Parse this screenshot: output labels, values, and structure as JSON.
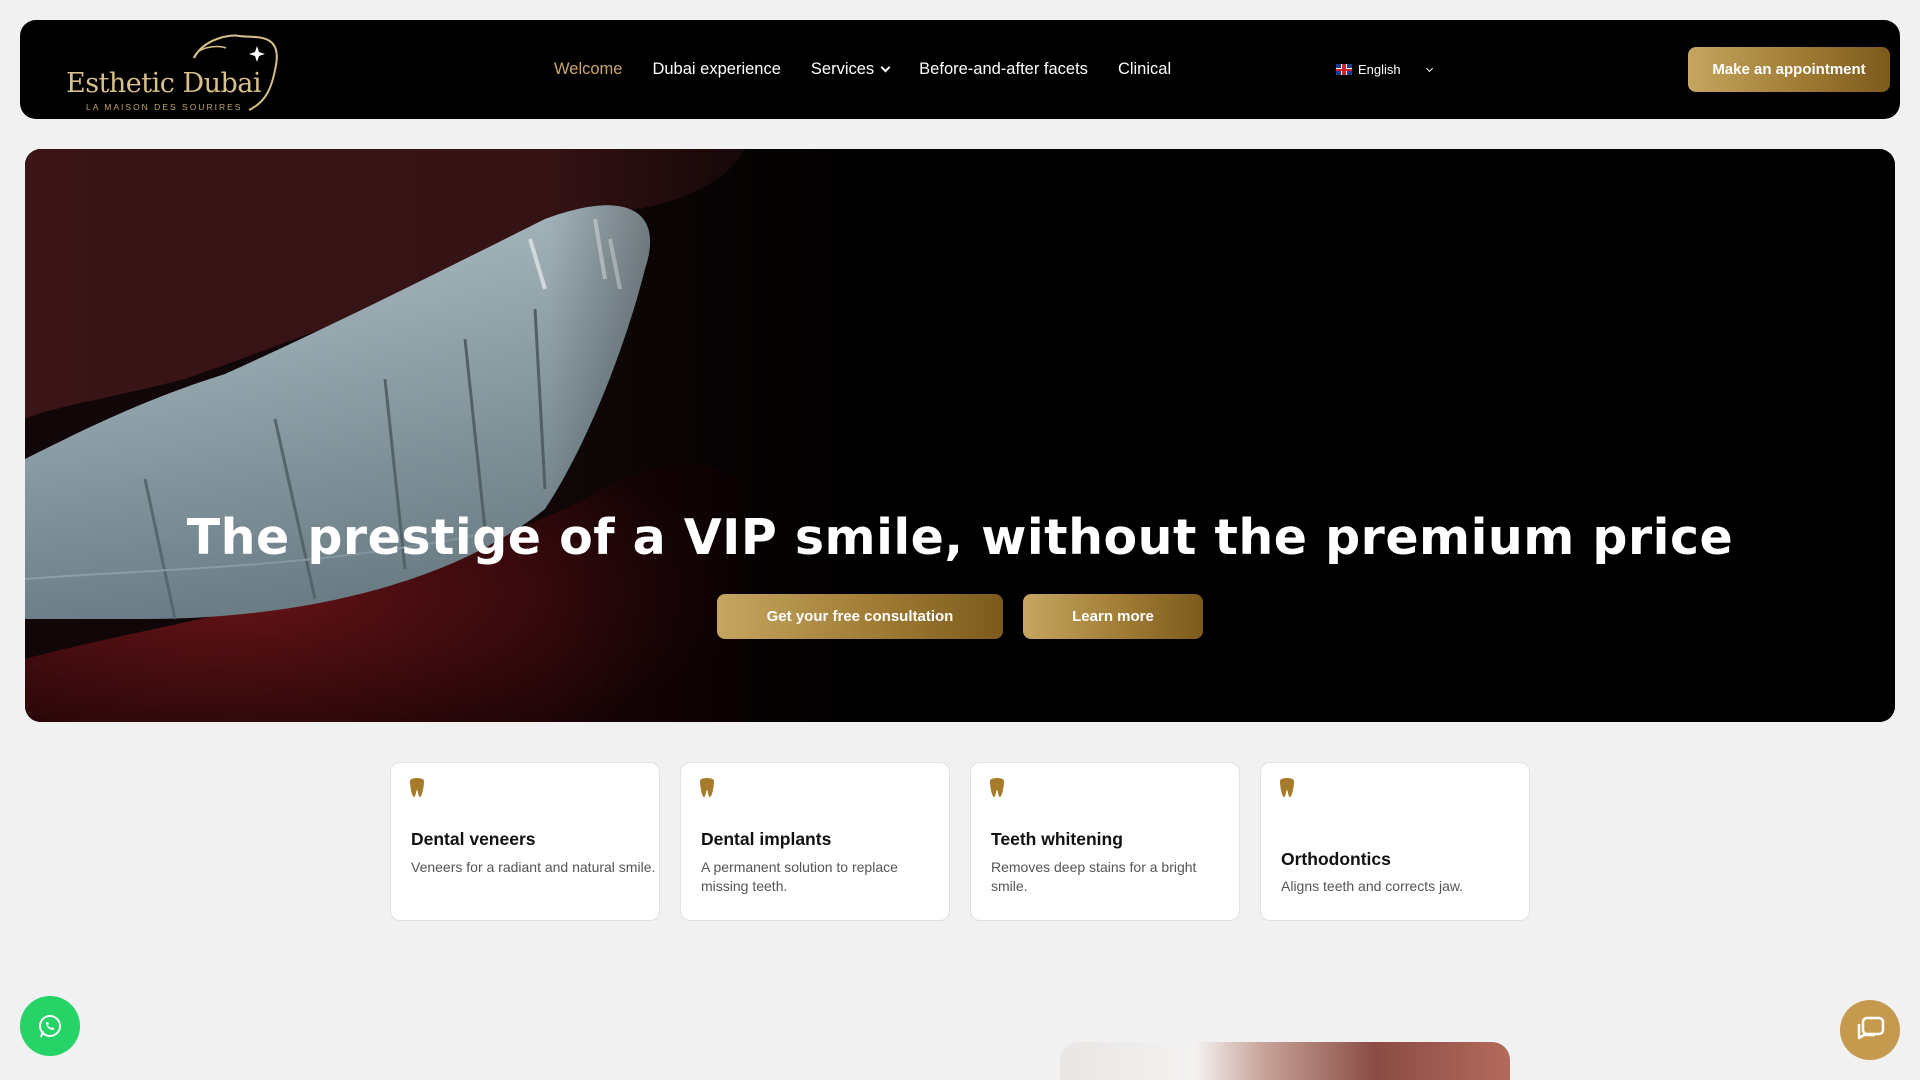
{
  "brand": {
    "name": "Esthetic Dubai",
    "tagline": "LA MAISON DES SOURIRES",
    "accent_color": "#c9a66b"
  },
  "nav": {
    "items": [
      {
        "label": "Welcome",
        "active": true
      },
      {
        "label": "Dubai experience",
        "active": false
      },
      {
        "label": "Services",
        "active": false,
        "has_dropdown": true
      },
      {
        "label": "Before-and-after facets",
        "active": false
      },
      {
        "label": "Clinical",
        "active": false
      }
    ]
  },
  "language": {
    "selected": "English",
    "flag_icon": "uk-flag-icon"
  },
  "header": {
    "cta_label": "Make an appointment"
  },
  "hero": {
    "title": "The prestige of a VIP smile, without the premium price",
    "primary_cta": "Get your free consultation",
    "secondary_cta": "Learn more"
  },
  "services": [
    {
      "icon": "tooth-icon",
      "title": "Dental veneers",
      "description": "Veneers for a radiant and natural smile."
    },
    {
      "icon": "tooth-icon",
      "title": "Dental implants",
      "description": "A permanent solution to replace missing teeth."
    },
    {
      "icon": "tooth-icon",
      "title": "Teeth whitening",
      "description": "Removes deep stains for a bright smile."
    },
    {
      "icon": "tooth-icon",
      "title": "Orthodontics",
      "description": "Aligns teeth and corrects jaw."
    }
  ],
  "floating": {
    "whatsapp_icon": "whatsapp-icon",
    "chat_icon": "chat-icon"
  },
  "colors": {
    "gold_start": "#c5a660",
    "gold_end": "#7c5a1c",
    "whatsapp": "#25d366"
  }
}
